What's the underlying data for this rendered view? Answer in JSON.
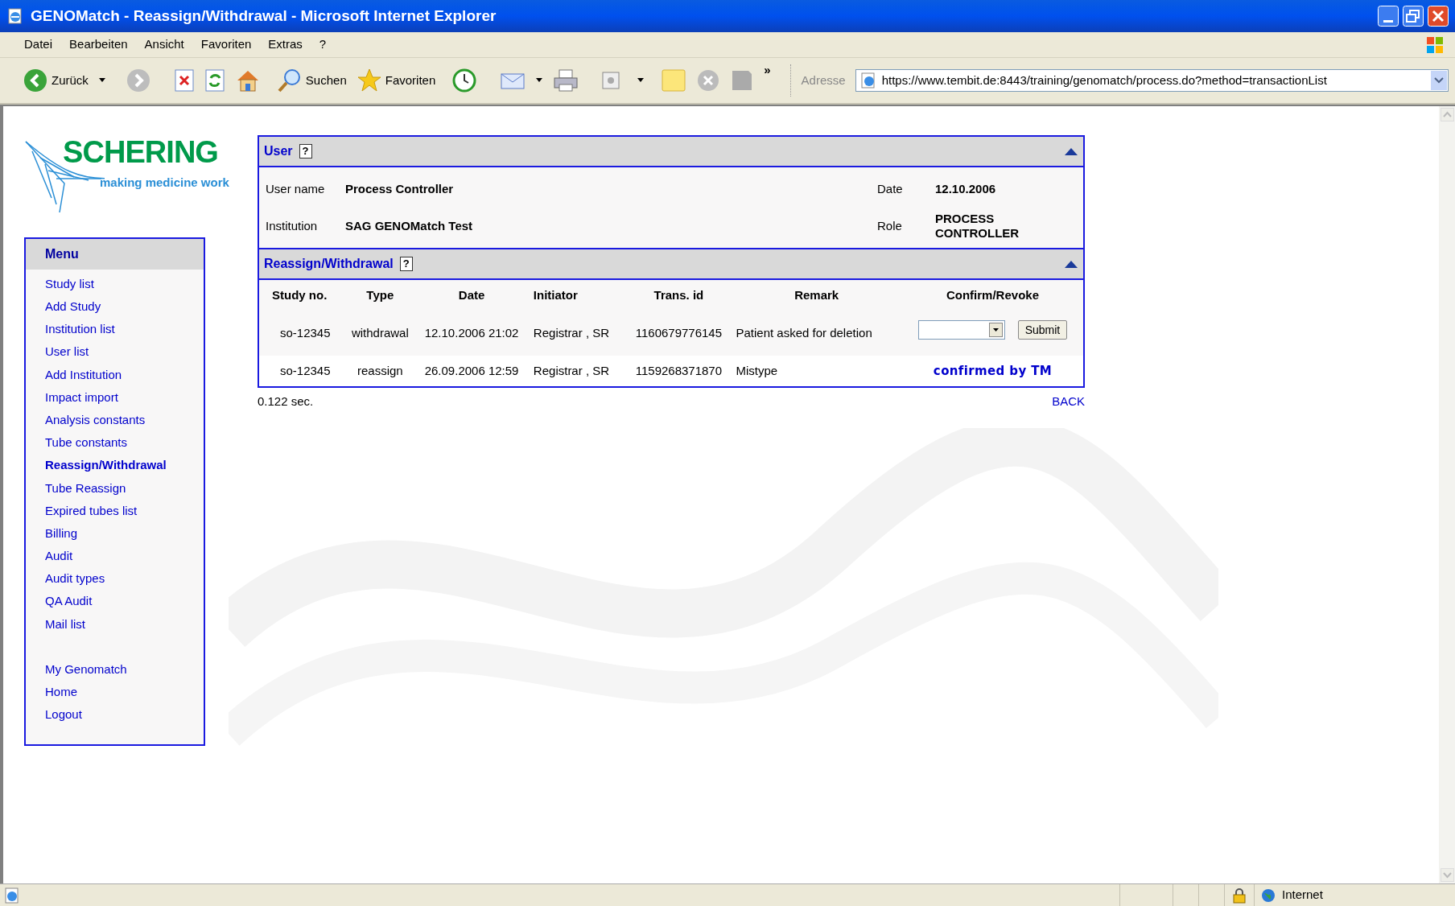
{
  "window": {
    "title": "GENOMatch - Reassign/Withdrawal - Microsoft Internet Explorer"
  },
  "menu_bar": [
    "Datei",
    "Bearbeiten",
    "Ansicht",
    "Favoriten",
    "Extras",
    "?"
  ],
  "toolbar": {
    "back": "Zurück",
    "search": "Suchen",
    "favorites": "Favoriten",
    "overflow": "»"
  },
  "address": {
    "label": "Adresse",
    "value": "https://www.tembit.de:8443/training/genomatch/process.do?method=transactionList"
  },
  "logo": {
    "name": "SCHERING",
    "tagline": "making medicine work"
  },
  "sidebar": {
    "title": "Menu",
    "groups": [
      [
        {
          "label": "Study list",
          "selected": false
        },
        {
          "label": "Add Study",
          "selected": false
        },
        {
          "label": "Institution list",
          "selected": false
        },
        {
          "label": "User list",
          "selected": false
        },
        {
          "label": "Add Institution",
          "selected": false
        },
        {
          "label": "Impact import",
          "selected": false
        },
        {
          "label": "Analysis constants",
          "selected": false
        },
        {
          "label": "Tube constants",
          "selected": false
        },
        {
          "label": "Reassign/Withdrawal",
          "selected": true
        },
        {
          "label": "Tube Reassign",
          "selected": false
        },
        {
          "label": "Expired tubes list",
          "selected": false
        },
        {
          "label": "Billing",
          "selected": false
        },
        {
          "label": "Audit",
          "selected": false
        },
        {
          "label": "Audit types",
          "selected": false
        },
        {
          "label": "QA Audit",
          "selected": false
        },
        {
          "label": "Mail list",
          "selected": false
        }
      ],
      [
        {
          "label": "My Genomatch",
          "selected": false
        },
        {
          "label": "Home",
          "selected": false
        },
        {
          "label": "Logout",
          "selected": false
        }
      ]
    ]
  },
  "user_panel": {
    "title": "User",
    "help": "?",
    "fields": [
      {
        "label": "User name",
        "value": "Process Controller"
      },
      {
        "label": "Date",
        "value": "12.10.2006"
      },
      {
        "label": "Institution",
        "value": "SAG GENOMatch Test"
      },
      {
        "label": "Role",
        "value": "PROCESS CONTROLLER"
      }
    ]
  },
  "transactions": {
    "title": "Reassign/Withdrawal",
    "help": "?",
    "columns": [
      "Study no.",
      "Type",
      "Date",
      "Initiator",
      "Trans. id",
      "Remark",
      "Confirm/Revoke"
    ],
    "rows": [
      {
        "cells": [
          "so-12345",
          "withdrawal",
          "12.10.2006 21:02",
          "Registrar , SR",
          "1160679776145",
          "Patient asked for deletion"
        ],
        "action": {
          "kind": "form",
          "button": "Submit"
        }
      },
      {
        "cells": [
          "so-12345",
          "reassign",
          "26.09.2006 12:59",
          "Registrar , SR",
          "1159268371870",
          "Mistype"
        ],
        "action": {
          "kind": "status",
          "text": "confirmed by TM"
        }
      }
    ]
  },
  "timing": "0.122 sec.",
  "back_link": "BACK",
  "status_bar": {
    "zone": "Internet"
  }
}
